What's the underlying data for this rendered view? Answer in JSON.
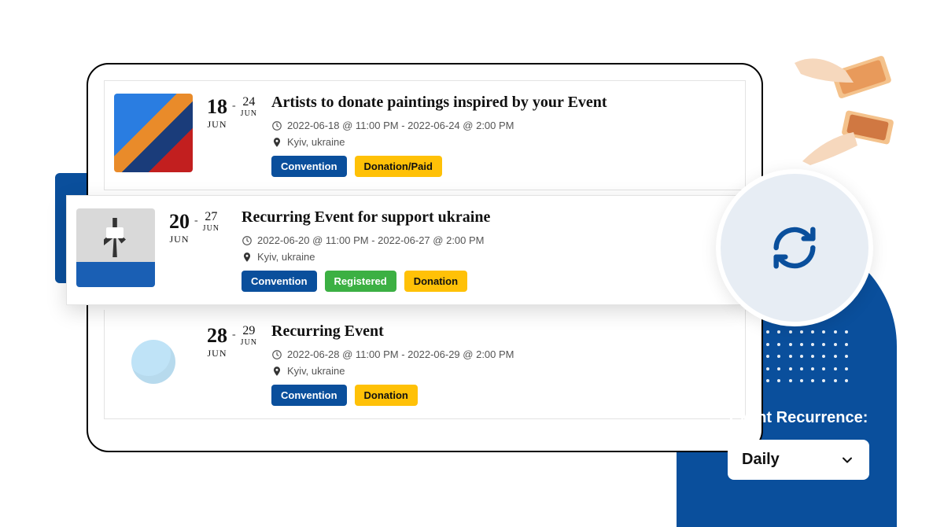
{
  "events": [
    {
      "start_day": "18",
      "start_mon": "JUN",
      "end_day": "24",
      "end_mon": "JUN",
      "title": "Artists to donate paintings inspired by your Event",
      "time": "2022-06-18 @ 11:00 PM - 2022-06-24 @ 2:00 PM",
      "location": "Kyiv, ukraine",
      "tags": [
        {
          "label": "Convention",
          "style": "blue"
        },
        {
          "label": "Donation/Paid",
          "style": "yellow"
        }
      ],
      "thumb": "art",
      "popped": false
    },
    {
      "start_day": "20",
      "start_mon": "JUN",
      "end_day": "27",
      "end_mon": "JUN",
      "title": "Recurring Event for support ukraine",
      "time": "2022-06-20 @ 11:00 PM - 2022-06-27 @ 2:00 PM",
      "location": "Kyiv, ukraine",
      "tags": [
        {
          "label": "Convention",
          "style": "blue"
        },
        {
          "label": "Registered",
          "style": "green"
        },
        {
          "label": "Donation",
          "style": "yellow"
        }
      ],
      "thumb": "runner",
      "popped": true
    },
    {
      "start_day": "28",
      "start_mon": "JUN",
      "end_day": "29",
      "end_mon": "JUN",
      "title": "Recurring Event",
      "time": "2022-06-28 @ 11:00 PM - 2022-06-29 @ 2:00 PM",
      "location": "Kyiv, ukraine",
      "tags": [
        {
          "label": "Convention",
          "style": "blue"
        },
        {
          "label": "Donation",
          "style": "yellow"
        }
      ],
      "thumb": "balloon",
      "popped": false
    }
  ],
  "recurrence": {
    "label": "Event Recurrence:",
    "selected": "Daily"
  }
}
